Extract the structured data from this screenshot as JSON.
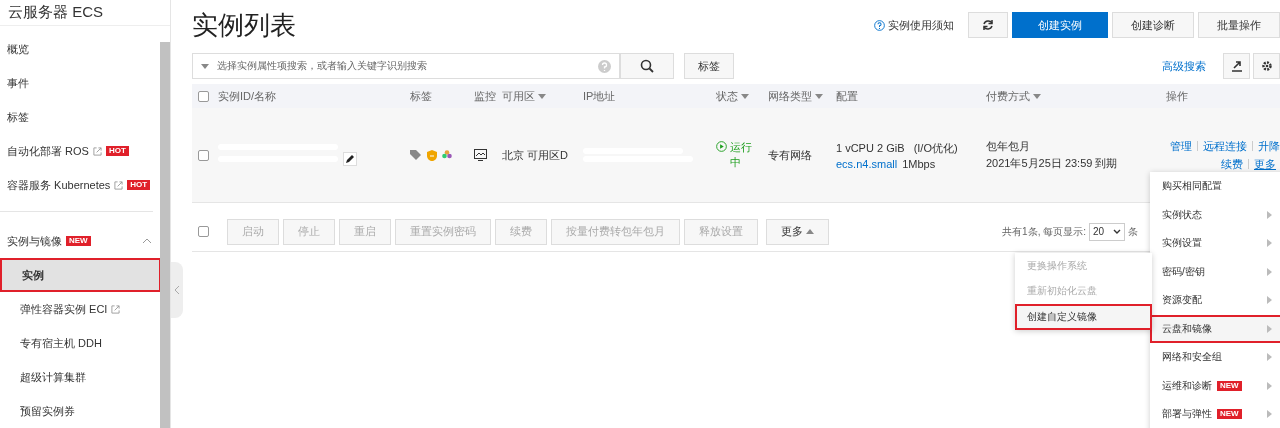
{
  "sidebar": {
    "title": "云服务器 ECS",
    "items": [
      {
        "label": "概览",
        "external": false
      },
      {
        "label": "事件",
        "external": false
      },
      {
        "label": "标签",
        "external": false
      },
      {
        "label": "自动化部署 ROS",
        "external": true,
        "badge": "HOT"
      },
      {
        "label": "容器服务 Kubernetes",
        "external": true,
        "badge": "HOT"
      }
    ],
    "group": {
      "label": "实例与镜像",
      "badge": "NEW",
      "expanded": true,
      "items": [
        {
          "label": "实例",
          "selected": true,
          "external": false
        },
        {
          "label": "弹性容器实例 ECI",
          "selected": false,
          "external": true
        },
        {
          "label": "专有宿主机 DDH",
          "selected": false,
          "external": false
        },
        {
          "label": "超级计算集群",
          "selected": false,
          "external": false
        },
        {
          "label": "预留实例券",
          "selected": false,
          "external": false
        }
      ]
    }
  },
  "page": {
    "title": "实例列表",
    "help_link": "实例使用须知",
    "buttons": [
      {
        "kind": "icon"
      },
      {
        "kind": "primary",
        "label": "创建实例"
      },
      {
        "kind": "default",
        "label": "创建诊断"
      },
      {
        "kind": "default",
        "label": "批量操作"
      }
    ]
  },
  "search": {
    "placeholder": "选择实例属性项搜索，或者输入关键字识别搜索",
    "tag_button": "标签",
    "advanced_link": "高级搜索"
  },
  "table": {
    "select_all": {
      "checked": false
    },
    "columns": [
      {
        "label": "实例ID/名称",
        "sortable": false
      },
      {
        "label": "标签",
        "sortable": false
      },
      {
        "label": "监控",
        "sortable": false
      },
      {
        "label": "可用区",
        "sortable": true
      },
      {
        "label": "IP地址",
        "sortable": false
      },
      {
        "label": "状态",
        "sortable": true
      },
      {
        "label": "网络类型",
        "sortable": true
      },
      {
        "label": "配置",
        "sortable": false
      },
      {
        "label": "付费方式",
        "sortable": true
      },
      {
        "label": "操作",
        "sortable": false
      }
    ],
    "rows": [
      {
        "selected": false,
        "zone": "北京 可用区D",
        "status": "运行中",
        "network": "专有网络",
        "spec": "1 vCPU 2 GiB   (I/O优化)",
        "instance_type": "ecs.n4.small",
        "bandwidth": "1Mbps",
        "billing": "包年包月",
        "expiry": "2021年5月25日 23:59 到期",
        "actions": [
          "管理",
          "远程连接",
          "升降"
        ],
        "actions2": [
          "续费",
          "更多"
        ]
      }
    ]
  },
  "bulk_actions": {
    "select_all": {
      "checked": false
    },
    "buttons": [
      {
        "label": "启动",
        "disabled": true
      },
      {
        "label": "停止",
        "disabled": true
      },
      {
        "label": "重启",
        "disabled": true
      },
      {
        "label": "重置实例密码",
        "disabled": true
      },
      {
        "label": "续费",
        "disabled": true
      },
      {
        "label": "按量付费转包年包月",
        "disabled": true
      },
      {
        "label": "释放设置",
        "disabled": true
      },
      {
        "label": "更多",
        "disabled": false
      }
    ],
    "pagination": {
      "summary": "共有1条, 每页显示:",
      "page_size": "20",
      "unit": "条"
    }
  },
  "more_menu": {
    "items": [
      {
        "label": "购买相同配置",
        "submenu": false,
        "highlighted": false
      },
      {
        "label": "实例状态",
        "submenu": true,
        "highlighted": false
      },
      {
        "label": "实例设置",
        "submenu": true,
        "highlighted": false
      },
      {
        "label": "密码/密钥",
        "submenu": true,
        "highlighted": false
      },
      {
        "label": "资源变配",
        "submenu": true,
        "highlighted": false
      },
      {
        "label": "云盘和镜像",
        "submenu": true,
        "highlighted": true
      },
      {
        "label": "网络和安全组",
        "submenu": true,
        "highlighted": false
      },
      {
        "label": "运维和诊断",
        "submenu": true,
        "highlighted": false,
        "badge": "NEW"
      },
      {
        "label": "部署与弹性",
        "submenu": true,
        "highlighted": false,
        "badge": "NEW"
      }
    ],
    "submenu": [
      {
        "label": "更换操作系统",
        "disabled": true,
        "highlighted": false
      },
      {
        "label": "重新初始化云盘",
        "disabled": true,
        "highlighted": false
      },
      {
        "label": "创建自定义镜像",
        "disabled": false,
        "highlighted": true
      }
    ]
  }
}
